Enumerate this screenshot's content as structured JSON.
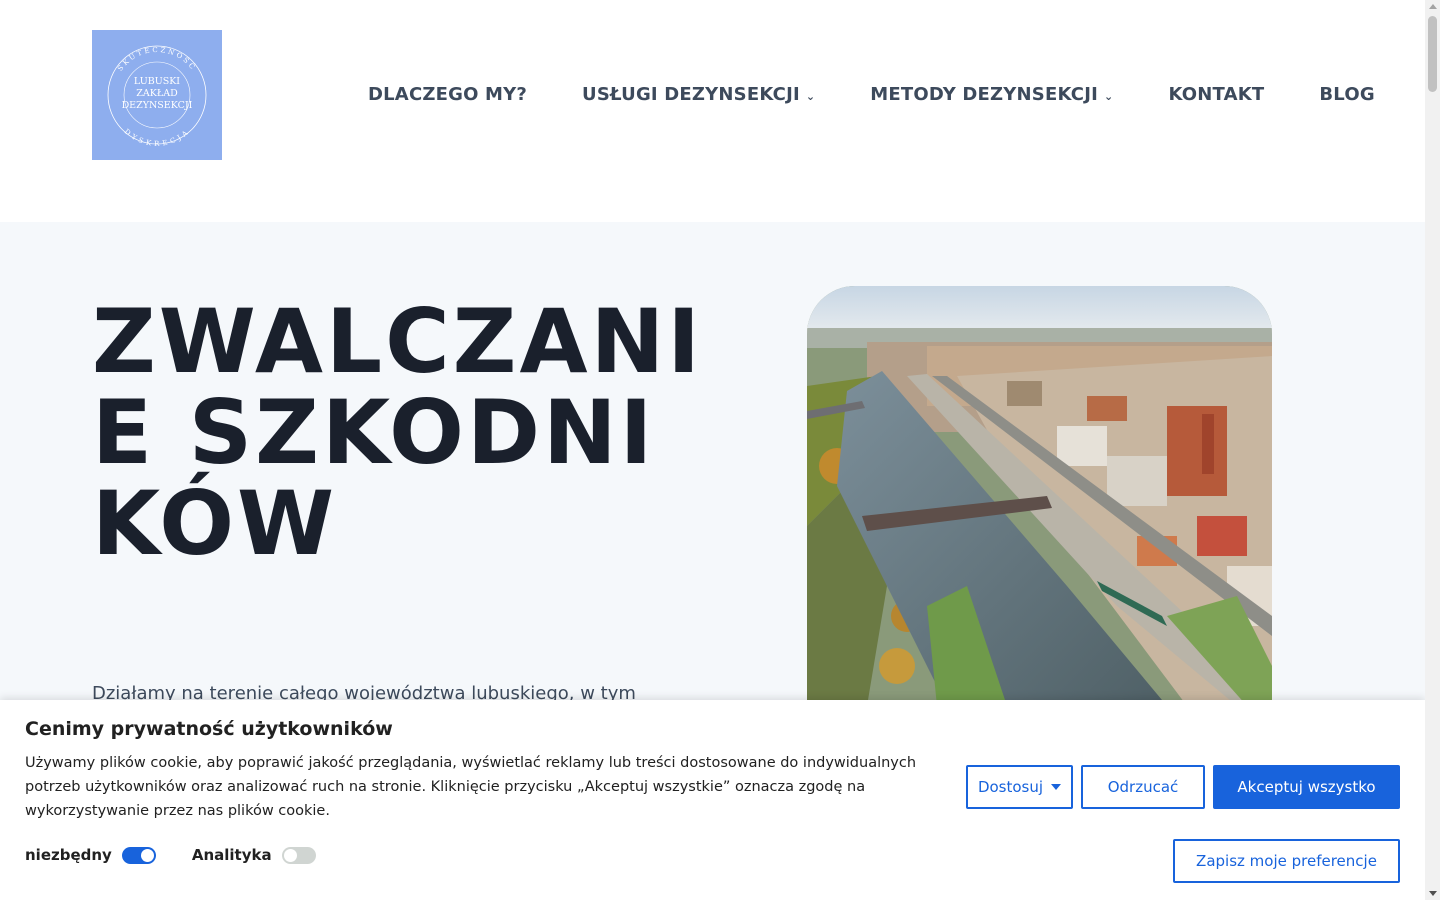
{
  "logo": {
    "line1": "LUBUSKI",
    "line2": "ZAKŁAD",
    "line3": "DEZYNSEKCJI",
    "arc_top": "SKUTECZNOŚĆ",
    "arc_bottom": "DYSKRECJA",
    "bg_color": "#8eaeee"
  },
  "nav": {
    "items": [
      {
        "label": "DLACZEGO MY?",
        "has_dropdown": false
      },
      {
        "label": "USŁUGI DEZYNSEKCJI",
        "has_dropdown": true
      },
      {
        "label": "METODY DEZYNSEKCJI",
        "has_dropdown": true
      },
      {
        "label": "KONTAKT",
        "has_dropdown": false
      },
      {
        "label": "BLOG",
        "has_dropdown": false
      }
    ],
    "dropdown_icon": "chevron-down-icon"
  },
  "hero": {
    "title": "ZWALCZANIE SZKODNIKÓW",
    "text": "Działamy na terenie całego województwa lubuskiego, w tym",
    "image": "aerial-city-river-photo"
  },
  "cookie": {
    "title": "Cenimy prywatność użytkowników",
    "text": "Używamy plików cookie, aby poprawić jakość przeglądania, wyświetlać reklamy lub treści dostosowane do indywidualnych potrzeb użytkowników oraz analizować ruch na stronie. Kliknięcie przycisku „Akceptuj wszystkie” oznacza zgodę na wykorzystywanie przez nas plików cookie.",
    "customize_label": "Dostosuj",
    "reject_label": "Odrzucać",
    "accept_label": "Akceptuj wszystko",
    "save_label": "Zapisz moje preferencje",
    "toggles": [
      {
        "label": "niezbędny",
        "on": true
      },
      {
        "label": "Analityka",
        "on": false
      }
    ],
    "accent_color": "#1863dc"
  }
}
